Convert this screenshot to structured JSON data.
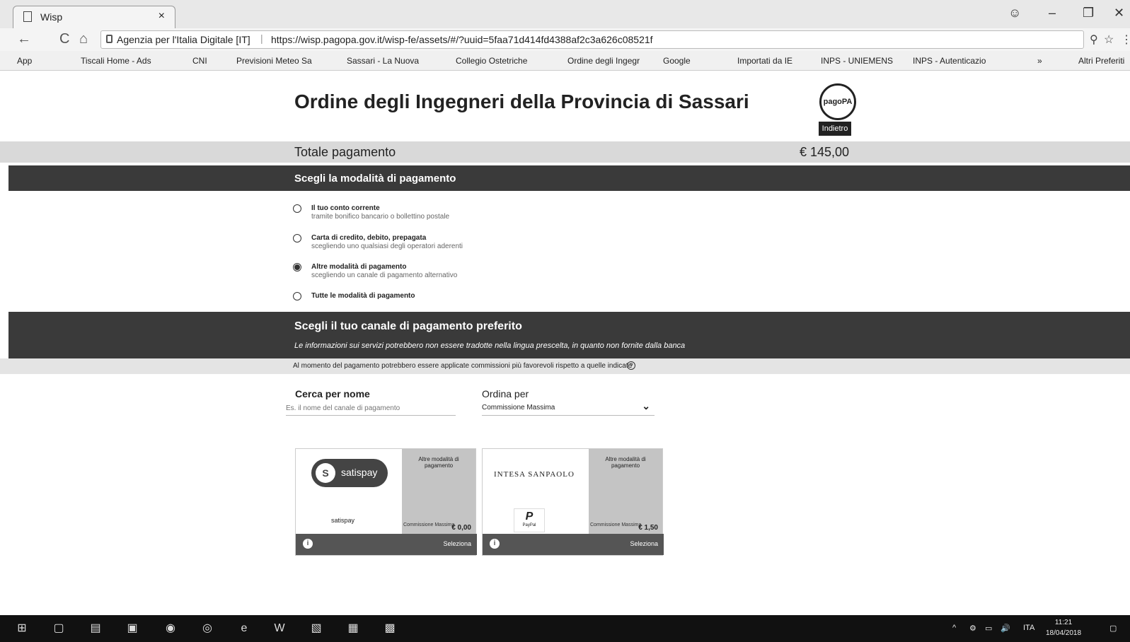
{
  "browser": {
    "tab_title": "Wisp",
    "tab_close": "×",
    "window_controls": {
      "account": "☺",
      "minimize": "–",
      "restore": "❐",
      "close": "✕"
    },
    "nav": {
      "back": "←",
      "reload": "C",
      "home": "⌂"
    },
    "address": {
      "org": "Agenzia per l'Italia Digitale [IT]",
      "separator": "|",
      "url": "https://wisp.pagopa.gov.it/wisp-fe/assets/#/?uuid=5faa71d414fd4388af2c3a626c08521f"
    },
    "zoom_icon": "⚲",
    "star_icon": "☆",
    "menu_icon": "⋮",
    "bookmarks": [
      "App",
      "Tiscali Home - Ads",
      "CNI",
      "Previsioni Meteo Sa",
      "Sassari - La Nuova",
      "Collegio Ostetriche",
      "Ordine degli Ingegr",
      "Google",
      "Importati da IE",
      "INPS - UNIEMENS",
      "INPS - Autenticazio",
      "»",
      "Altri Preferiti"
    ]
  },
  "page": {
    "title": "Ordine degli Ingegneri della Provincia di Sassari",
    "logo_text": "pagoPA",
    "back_button": "Indietro",
    "total_label": "Totale pagamento",
    "total_amount": "€ 145,00",
    "payment_mode_heading": "Scegli la modalità di pagamento",
    "payment_options": [
      {
        "label": "Il tuo conto corrente",
        "sub": "tramite bonifico bancario o bollettino postale",
        "selected": false
      },
      {
        "label": "Carta di credito, debito, prepagata",
        "sub": "scegliendo uno qualsiasi degli operatori aderenti",
        "selected": false
      },
      {
        "label": "Altre modalità di pagamento",
        "sub": "scegliendo un canale di pagamento alternativo",
        "selected": true
      },
      {
        "label": "Tutte le modalità di pagamento",
        "sub": "",
        "selected": false
      }
    ],
    "channel_heading": "Scegli il tuo canale di pagamento preferito",
    "channel_note": "Le informazioni sui servizi potrebbero non essere tradotte nella lingua prescelta, in quanto non fornite dalla banca",
    "fee_note": "Al momento del pagamento potrebbero essere applicate commissioni più favorevoli rispetto a quelle indicate",
    "help_icon": "?",
    "search_label": "Cerca per nome",
    "search_placeholder": "Es. il nome del canale di pagamento",
    "sort_label": "Ordina per",
    "sort_value": "Commissione Massima",
    "sort_chevron": "⌄",
    "cards": [
      {
        "brand": "satispay",
        "brand_icon": "S",
        "name": "satispay",
        "type": "Altre modalità di pagamento",
        "fee_label": "Commissione Massima",
        "fee": "€ 0,00",
        "info": "i",
        "select": "Seleziona"
      },
      {
        "brand": "INTESA SANPAOLO",
        "paypal_icon": "P",
        "paypal_text": "PayPal",
        "type": "Altre modalità di pagamento",
        "fee_label": "Commissione Massima",
        "fee": "€ 1,50",
        "info": "i",
        "select": "Seleziona"
      }
    ]
  },
  "taskbar": {
    "start_icon": "⊞",
    "icons": [
      "▢",
      "▤",
      "▣",
      "◉",
      "◎",
      "e",
      "W",
      "▧",
      "▦",
      "▩"
    ],
    "tray_up": "^",
    "tray_icons": [
      "⚙",
      "▭",
      "🔊"
    ],
    "lang": "ITA",
    "time": "11:21",
    "date": "18/04/2018",
    "notif_icon": "▢"
  }
}
